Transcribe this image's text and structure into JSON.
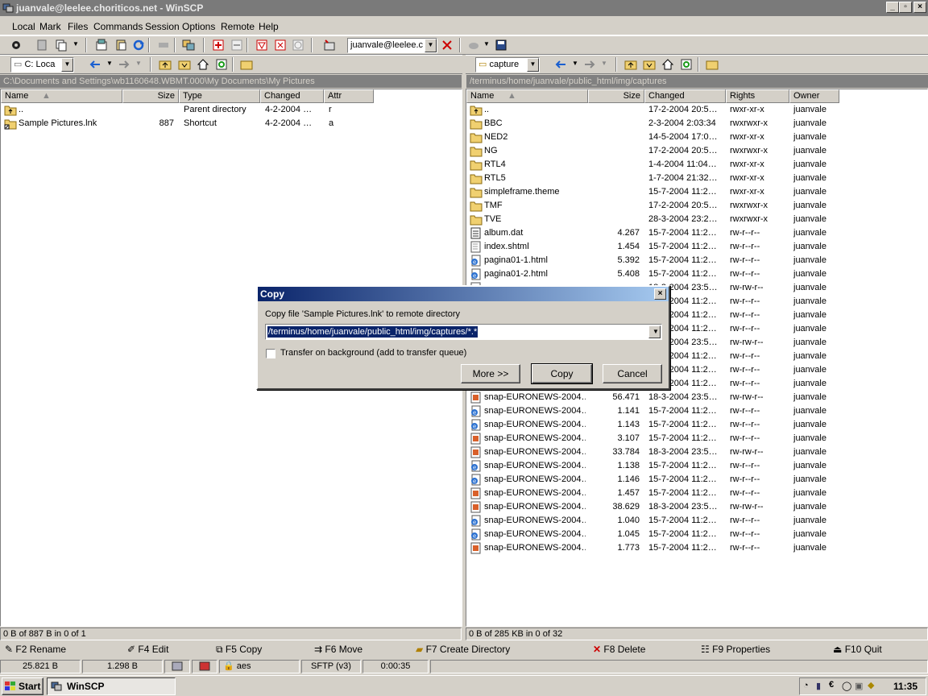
{
  "window": {
    "title": "juanvale@leelee.choriticos.net - WinSCP",
    "controls": {
      "minimize": "_",
      "maximize": "▫",
      "close": "×"
    }
  },
  "menu": [
    "Local",
    "Mark",
    "Files",
    "Commands",
    "Session",
    "Options",
    "Remote",
    "Help"
  ],
  "toolbar": {
    "session_combo": "juanvale@leelee.c"
  },
  "local": {
    "drive": "C: Loca",
    "path": "C:\\Documents and Settings\\wb1160648.WBMT.000\\My Documents\\My Pictures",
    "columns": [
      "Name",
      "Size",
      "Type",
      "Changed",
      "Attr"
    ],
    "rows": [
      {
        "name": "..",
        "size": "",
        "type": "Parent directory",
        "changed": "4-2-2004 …",
        "attr": "r",
        "icon": "parent-folder"
      },
      {
        "name": "Sample Pictures.lnk",
        "size": "887",
        "type": "Shortcut",
        "changed": "4-2-2004 …",
        "attr": "a",
        "icon": "shortcut-folder"
      }
    ],
    "status": "0 B of 887 B in 0 of 1"
  },
  "remote": {
    "dir": "capture",
    "path": "/terminus/home/juanvale/public_html/img/captures",
    "columns": [
      "Name",
      "Size",
      "Changed",
      "Rights",
      "Owner"
    ],
    "rows": [
      {
        "name": "..",
        "size": "",
        "changed": "17-2-2004 20:5…",
        "rights": "rwxr-xr-x",
        "owner": "juanvale",
        "icon": "parent"
      },
      {
        "name": "BBC",
        "size": "",
        "changed": "2-3-2004 2:03:34",
        "rights": "rwxrwxr-x",
        "owner": "juanvale",
        "icon": "folder"
      },
      {
        "name": "NED2",
        "size": "",
        "changed": "14-5-2004 17:0…",
        "rights": "rwxr-xr-x",
        "owner": "juanvale",
        "icon": "folder"
      },
      {
        "name": "NG",
        "size": "",
        "changed": "17-2-2004 20:5…",
        "rights": "rwxrwxr-x",
        "owner": "juanvale",
        "icon": "folder"
      },
      {
        "name": "RTL4",
        "size": "",
        "changed": "1-4-2004 11:04…",
        "rights": "rwxr-xr-x",
        "owner": "juanvale",
        "icon": "folder"
      },
      {
        "name": "RTL5",
        "size": "",
        "changed": "1-7-2004 21:32…",
        "rights": "rwxr-xr-x",
        "owner": "juanvale",
        "icon": "folder"
      },
      {
        "name": "simpleframe.theme",
        "size": "",
        "changed": "15-7-2004 11:2…",
        "rights": "rwxr-xr-x",
        "owner": "juanvale",
        "icon": "folder"
      },
      {
        "name": "TMF",
        "size": "",
        "changed": "17-2-2004 20:5…",
        "rights": "rwxrwxr-x",
        "owner": "juanvale",
        "icon": "folder"
      },
      {
        "name": "TVE",
        "size": "",
        "changed": "28-3-2004 23:2…",
        "rights": "rwxrwxr-x",
        "owner": "juanvale",
        "icon": "folder"
      },
      {
        "name": "album.dat",
        "size": "4.267",
        "changed": "15-7-2004 11:2…",
        "rights": "rw-r--r--",
        "owner": "juanvale",
        "icon": "dat"
      },
      {
        "name": "index.shtml",
        "size": "1.454",
        "changed": "15-7-2004 11:2…",
        "rights": "rw-r--r--",
        "owner": "juanvale",
        "icon": "doc"
      },
      {
        "name": "pagina01-1.html",
        "size": "5.392",
        "changed": "15-7-2004 11:2…",
        "rights": "rw-r--r--",
        "owner": "juanvale",
        "icon": "html"
      },
      {
        "name": "pagina01-2.html",
        "size": "5.408",
        "changed": "15-7-2004 11:2…",
        "rights": "rw-r--r--",
        "owner": "juanvale",
        "icon": "html"
      },
      {
        "name": "",
        "size": "",
        "changed": "18-3-2004 23:5…",
        "rights": "rw-rw-r--",
        "owner": "juanvale",
        "icon": "img"
      },
      {
        "name": "",
        "size": "",
        "changed": "15-7-2004 11:2…",
        "rights": "rw-r--r--",
        "owner": "juanvale",
        "icon": "html"
      },
      {
        "name": "",
        "size": "",
        "changed": "15-7-2004 11:2…",
        "rights": "rw-r--r--",
        "owner": "juanvale",
        "icon": "html"
      },
      {
        "name": "",
        "size": "",
        "changed": "15-7-2004 11:2…",
        "rights": "rw-r--r--",
        "owner": "juanvale",
        "icon": "img"
      },
      {
        "name": "",
        "size": "",
        "changed": "18-3-2004 23:5…",
        "rights": "rw-rw-r--",
        "owner": "juanvale",
        "icon": "img"
      },
      {
        "name": "",
        "size": "",
        "changed": "15-7-2004 11:2…",
        "rights": "rw-r--r--",
        "owner": "juanvale",
        "icon": "html"
      },
      {
        "name": "",
        "size": "",
        "changed": "15-7-2004 11:2…",
        "rights": "rw-r--r--",
        "owner": "juanvale",
        "icon": "html"
      },
      {
        "name": "",
        "size": "",
        "changed": "15-7-2004 11:2…",
        "rights": "rw-r--r--",
        "owner": "juanvale",
        "icon": "img"
      },
      {
        "name": "snap-EURONEWS-2004…",
        "size": "56.471",
        "changed": "18-3-2004 23:5…",
        "rights": "rw-rw-r--",
        "owner": "juanvale",
        "icon": "img"
      },
      {
        "name": "snap-EURONEWS-2004…",
        "size": "1.141",
        "changed": "15-7-2004 11:2…",
        "rights": "rw-r--r--",
        "owner": "juanvale",
        "icon": "html"
      },
      {
        "name": "snap-EURONEWS-2004…",
        "size": "1.143",
        "changed": "15-7-2004 11:2…",
        "rights": "rw-r--r--",
        "owner": "juanvale",
        "icon": "html"
      },
      {
        "name": "snap-EURONEWS-2004…",
        "size": "3.107",
        "changed": "15-7-2004 11:2…",
        "rights": "rw-r--r--",
        "owner": "juanvale",
        "icon": "img"
      },
      {
        "name": "snap-EURONEWS-2004…",
        "size": "33.784",
        "changed": "18-3-2004 23:5…",
        "rights": "rw-rw-r--",
        "owner": "juanvale",
        "icon": "img"
      },
      {
        "name": "snap-EURONEWS-2004…",
        "size": "1.138",
        "changed": "15-7-2004 11:2…",
        "rights": "rw-r--r--",
        "owner": "juanvale",
        "icon": "html"
      },
      {
        "name": "snap-EURONEWS-2004…",
        "size": "1.146",
        "changed": "15-7-2004 11:2…",
        "rights": "rw-r--r--",
        "owner": "juanvale",
        "icon": "html"
      },
      {
        "name": "snap-EURONEWS-2004…",
        "size": "1.457",
        "changed": "15-7-2004 11:2…",
        "rights": "rw-r--r--",
        "owner": "juanvale",
        "icon": "img"
      },
      {
        "name": "snap-EURONEWS-2004…",
        "size": "38.629",
        "changed": "18-3-2004 23:5…",
        "rights": "rw-rw-r--",
        "owner": "juanvale",
        "icon": "img"
      },
      {
        "name": "snap-EURONEWS-2004…",
        "size": "1.040",
        "changed": "15-7-2004 11:2…",
        "rights": "rw-r--r--",
        "owner": "juanvale",
        "icon": "html"
      },
      {
        "name": "snap-EURONEWS-2004…",
        "size": "1.045",
        "changed": "15-7-2004 11:2…",
        "rights": "rw-r--r--",
        "owner": "juanvale",
        "icon": "html"
      },
      {
        "name": "snap-EURONEWS-2004…",
        "size": "1.773",
        "changed": "15-7-2004 11:2…",
        "rights": "rw-r--r--",
        "owner": "juanvale",
        "icon": "img"
      }
    ],
    "status": "0 B of 285 KB in 0 of 32"
  },
  "dialog": {
    "title": "Copy",
    "prompt": "Copy file 'Sample Pictures.lnk' to remote directory",
    "target": "/terminus/home/juanvale/public_html/img/captures/*.*",
    "background_label": "Transfer on background (add to transfer queue)",
    "more": "More >>",
    "copy": "Copy",
    "cancel": "Cancel",
    "close": "×"
  },
  "fkeys": [
    "F2 Rename",
    "F4 Edit",
    "F5 Copy",
    "F6 Move",
    "F7 Create Directory",
    "F8 Delete",
    "F9 Properties",
    "F10 Quit"
  ],
  "statusbar": {
    "sent": "25.821 B",
    "received": "1.298 B",
    "cipher": "aes",
    "protocol": "SFTP (v3)",
    "elapsed": "0:00:35"
  },
  "taskbar": {
    "start": "Start",
    "task": "WinSCP",
    "clock": "11:35"
  },
  "colors": {
    "dialog_title_start": "#0a246a",
    "dialog_title_end": "#a6caf0",
    "selection": "#0a246a"
  }
}
